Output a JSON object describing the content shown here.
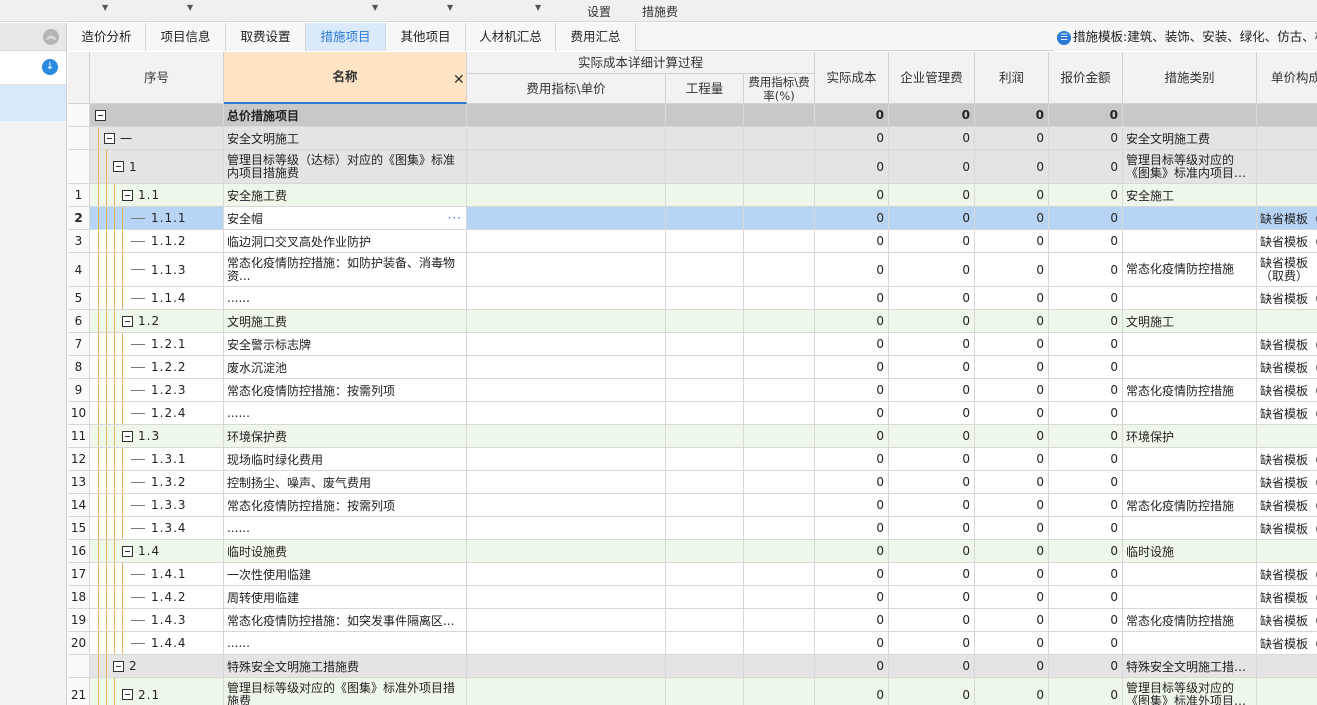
{
  "toolbar": {
    "settings": "设置",
    "measures_fee": "措施费"
  },
  "tabs": [
    {
      "label": "造价分析"
    },
    {
      "label": "项目信息"
    },
    {
      "label": "取费设置"
    },
    {
      "label": "措施项目"
    },
    {
      "label": "其他项目"
    },
    {
      "label": "人材机汇总"
    },
    {
      "label": "费用汇总"
    }
  ],
  "template_label": "措施模板:建筑、装饰、安装、绿化、仿古、构",
  "headers": {
    "seq": "序号",
    "name": "名称",
    "group": "实际成本详细计算过程",
    "fee_index": "费用指标\\单价",
    "quantity": "工程量",
    "rate": "费用指标\\费率(%)",
    "actual_cost": "实际成本",
    "mgmt_fee": "企业管理费",
    "profit": "利润",
    "quote": "报价金额",
    "category": "措施类别",
    "unit_price": "单价构成"
  },
  "rows": [
    {
      "seq": "",
      "code": "",
      "name": "总价措施项目",
      "level": 0,
      "type": "total",
      "cost": "0",
      "mgmt": "0",
      "profit": "0",
      "quote": "0",
      "cat": "",
      "unit": ""
    },
    {
      "seq": "",
      "code": "一",
      "name": "安全文明施工",
      "level": 1,
      "type": "group",
      "cost": "0",
      "mgmt": "0",
      "profit": "0",
      "quote": "0",
      "cat": "安全文明施工费",
      "unit": ""
    },
    {
      "seq": "",
      "code": "1",
      "name": "管理目标等级（达标）对应的《图集》标准内项目措施费",
      "level": 2,
      "type": "group",
      "tall": true,
      "cost": "0",
      "mgmt": "0",
      "profit": "0",
      "quote": "0",
      "cat": "管理目标等级对应的《图集》标准内项目…",
      "unit": ""
    },
    {
      "seq": "1",
      "code": "1.1",
      "name": "安全施工费",
      "level": 3,
      "type": "sub",
      "cost": "0",
      "mgmt": "0",
      "profit": "0",
      "quote": "0",
      "cat": "安全施工",
      "unit": ""
    },
    {
      "seq": "2",
      "code": "1.1.1",
      "name": "安全帽",
      "level": 4,
      "type": "selected",
      "cost": "0",
      "mgmt": "0",
      "profit": "0",
      "quote": "0",
      "cat": "",
      "unit": "缺省模板（"
    },
    {
      "seq": "3",
      "code": "1.1.2",
      "name": "临边洞口交叉高处作业防护",
      "level": 4,
      "type": "item",
      "cost": "0",
      "mgmt": "0",
      "profit": "0",
      "quote": "0",
      "cat": "",
      "unit": "缺省模板（"
    },
    {
      "seq": "4",
      "code": "1.1.3",
      "name": "常态化疫情防控措施：如防护装备、消毒物资...",
      "level": 4,
      "type": "item",
      "tall": true,
      "cost": "0",
      "mgmt": "0",
      "profit": "0",
      "quote": "0",
      "cat": "常态化疫情防控措施",
      "unit": "缺省模板（取费）"
    },
    {
      "seq": "5",
      "code": "1.1.4",
      "name": "......",
      "level": 4,
      "type": "item",
      "cost": "0",
      "mgmt": "0",
      "profit": "0",
      "quote": "0",
      "cat": "",
      "unit": "缺省模板（"
    },
    {
      "seq": "6",
      "code": "1.2",
      "name": "文明施工费",
      "level": 3,
      "type": "sub",
      "cost": "0",
      "mgmt": "0",
      "profit": "0",
      "quote": "0",
      "cat": "文明施工",
      "unit": ""
    },
    {
      "seq": "7",
      "code": "1.2.1",
      "name": "安全警示标志牌",
      "level": 4,
      "type": "item",
      "cost": "0",
      "mgmt": "0",
      "profit": "0",
      "quote": "0",
      "cat": "",
      "unit": "缺省模板（"
    },
    {
      "seq": "8",
      "code": "1.2.2",
      "name": "废水沉淀池",
      "level": 4,
      "type": "item",
      "cost": "0",
      "mgmt": "0",
      "profit": "0",
      "quote": "0",
      "cat": "",
      "unit": "缺省模板（"
    },
    {
      "seq": "9",
      "code": "1.2.3",
      "name": "常态化疫情防控措施：按需列项",
      "level": 4,
      "type": "item",
      "cost": "0",
      "mgmt": "0",
      "profit": "0",
      "quote": "0",
      "cat": "常态化疫情防控措施",
      "unit": "缺省模板（"
    },
    {
      "seq": "10",
      "code": "1.2.4",
      "name": "......",
      "level": 4,
      "type": "item",
      "cost": "0",
      "mgmt": "0",
      "profit": "0",
      "quote": "0",
      "cat": "",
      "unit": "缺省模板（"
    },
    {
      "seq": "11",
      "code": "1.3",
      "name": "环境保护费",
      "level": 3,
      "type": "sub",
      "cost": "0",
      "mgmt": "0",
      "profit": "0",
      "quote": "0",
      "cat": "环境保护",
      "unit": ""
    },
    {
      "seq": "12",
      "code": "1.3.1",
      "name": "现场临时绿化费用",
      "level": 4,
      "type": "item",
      "cost": "0",
      "mgmt": "0",
      "profit": "0",
      "quote": "0",
      "cat": "",
      "unit": "缺省模板（"
    },
    {
      "seq": "13",
      "code": "1.3.2",
      "name": "控制扬尘、噪声、废气费用",
      "level": 4,
      "type": "item",
      "cost": "0",
      "mgmt": "0",
      "profit": "0",
      "quote": "0",
      "cat": "",
      "unit": "缺省模板（"
    },
    {
      "seq": "14",
      "code": "1.3.3",
      "name": "常态化疫情防控措施：按需列项",
      "level": 4,
      "type": "item",
      "cost": "0",
      "mgmt": "0",
      "profit": "0",
      "quote": "0",
      "cat": "常态化疫情防控措施",
      "unit": "缺省模板（"
    },
    {
      "seq": "15",
      "code": "1.3.4",
      "name": "......",
      "level": 4,
      "type": "item",
      "cost": "0",
      "mgmt": "0",
      "profit": "0",
      "quote": "0",
      "cat": "",
      "unit": "缺省模板（"
    },
    {
      "seq": "16",
      "code": "1.4",
      "name": "临时设施费",
      "level": 3,
      "type": "sub",
      "cost": "0",
      "mgmt": "0",
      "profit": "0",
      "quote": "0",
      "cat": "临时设施",
      "unit": ""
    },
    {
      "seq": "17",
      "code": "1.4.1",
      "name": "一次性使用临建",
      "level": 4,
      "type": "item",
      "cost": "0",
      "mgmt": "0",
      "profit": "0",
      "quote": "0",
      "cat": "",
      "unit": "缺省模板（"
    },
    {
      "seq": "18",
      "code": "1.4.2",
      "name": "周转使用临建",
      "level": 4,
      "type": "item",
      "cost": "0",
      "mgmt": "0",
      "profit": "0",
      "quote": "0",
      "cat": "",
      "unit": "缺省模板（"
    },
    {
      "seq": "19",
      "code": "1.4.3",
      "name": "常态化疫情防控措施：如突发事件隔离区...",
      "level": 4,
      "type": "item",
      "cost": "0",
      "mgmt": "0",
      "profit": "0",
      "quote": "0",
      "cat": "常态化疫情防控措施",
      "unit": "缺省模板（"
    },
    {
      "seq": "20",
      "code": "1.4.4",
      "name": "......",
      "level": 4,
      "type": "item",
      "cost": "0",
      "mgmt": "0",
      "profit": "0",
      "quote": "0",
      "cat": "",
      "unit": "缺省模板（"
    },
    {
      "seq": "",
      "code": "2",
      "name": "特殊安全文明施工措施费",
      "level": 2,
      "type": "group",
      "cost": "0",
      "mgmt": "0",
      "profit": "0",
      "quote": "0",
      "cat": "特殊安全文明施工措…",
      "unit": ""
    },
    {
      "seq": "21",
      "code": "2.1",
      "name": "管理目标等级对应的《图集》标准外项目措施费",
      "level": 3,
      "type": "sub",
      "tall": true,
      "cost": "0",
      "mgmt": "0",
      "profit": "0",
      "quote": "0",
      "cat": "管理目标等级对应的《图集》标准外项目…",
      "unit": ""
    }
  ]
}
